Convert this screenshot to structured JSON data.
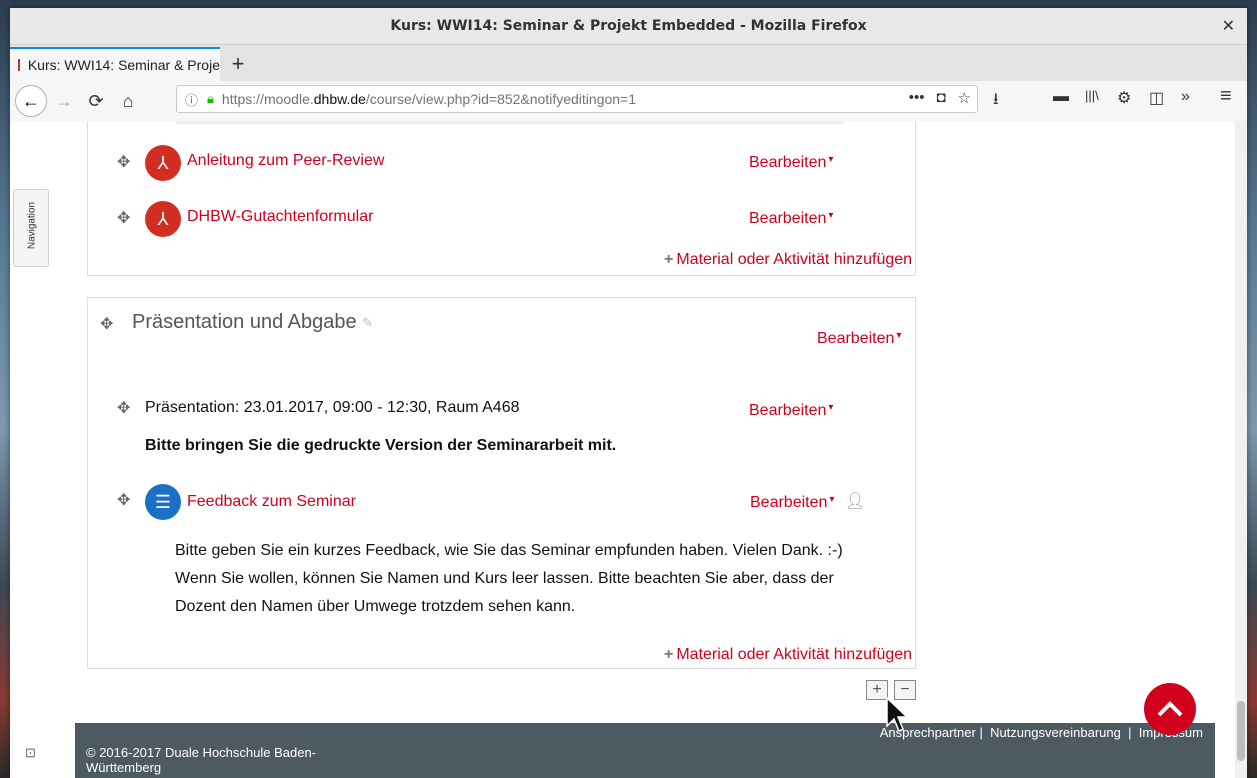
{
  "window": {
    "title": "Kurs: WWI14: Seminar & Projekt Embedded - Mozilla Firefox",
    "close_glyph": "✕"
  },
  "tab": {
    "label": "Kurs: WWI14: Seminar & Proje",
    "new_tab_glyph": "+"
  },
  "nav": {
    "back": "←",
    "forward": "→",
    "reload": "⟳",
    "home": "⌂"
  },
  "url": {
    "prefix": "https://moodle.",
    "host": "dhbw.de",
    "path": "/course/view.php?id=852&notifyeditingon=1"
  },
  "url_icons": {
    "more": "•••",
    "pocket": "◘",
    "star": "☆"
  },
  "toolbar_icons": {
    "download": "⭳",
    "screen": "▬",
    "library": "|||\\",
    "addon": "⚙",
    "sidebar": "◫",
    "overflow": "»",
    "menu": "≡"
  },
  "sidebar": {
    "navigation_label": "Navigation"
  },
  "section1": {
    "items": [
      {
        "title": "Anleitung zum Peer-Review",
        "edit": "Bearbeiten"
      },
      {
        "title": "DHBW-Gutachtenformular",
        "edit": "Bearbeiten"
      }
    ],
    "add_activity": "Material oder Aktivität hinzufügen"
  },
  "section2": {
    "title": "Präsentation und Abgabe",
    "edit": "Bearbeiten",
    "label_item": {
      "text": "Präsentation: 23.01.2017, 09:00 - 12:30, Raum A468",
      "bold": "Bitte bringen Sie die gedruckte Version der Seminararbeit mit.",
      "edit": "Bearbeiten"
    },
    "feedback_item": {
      "title": "Feedback zum Seminar",
      "edit": "Bearbeiten",
      "description_line1": "Bitte geben Sie ein kurzes Feedback, wie Sie das Seminar empfunden haben. Vielen Dank. :-)",
      "description_line2": "Wenn Sie wollen, können Sie Namen und Kurs leer lassen. Bitte beachten Sie aber, dass der",
      "description_line3": "Dozent den Namen über Umwege trotzdem sehen kann."
    },
    "add_activity": "Material oder Aktivität hinzufügen"
  },
  "footer": {
    "link1": "Ansprechpartner",
    "link2": "Nutzungsvereinbarung",
    "link3": "Impressum",
    "copyright": "© 2016-2017 Duale Hochschule Baden-Württemberg"
  },
  "colors": {
    "accent": "#d1001c",
    "footer_bg": "#4e5a62"
  }
}
